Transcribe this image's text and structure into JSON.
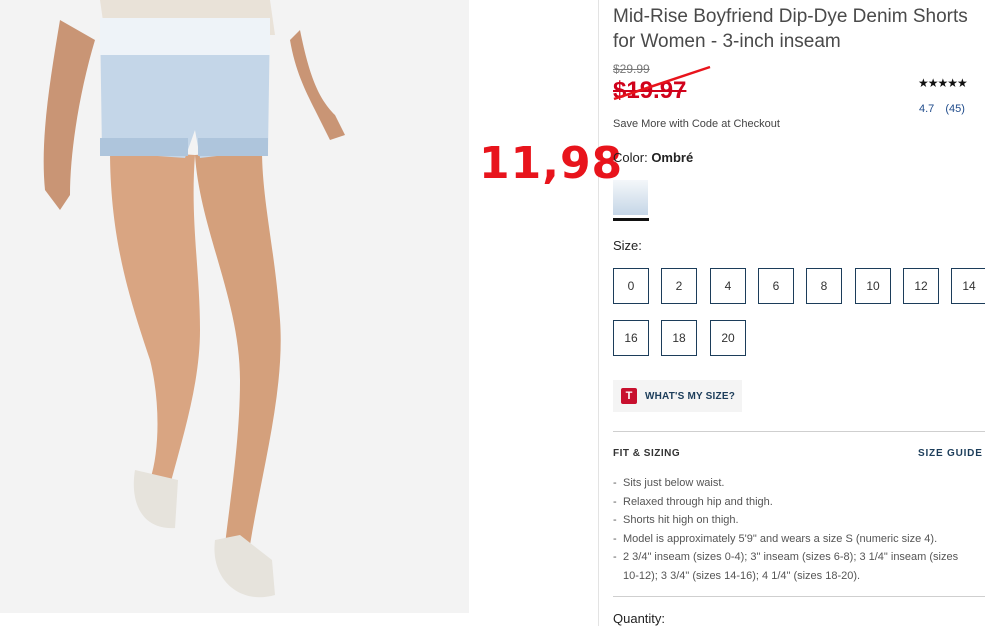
{
  "product": {
    "title_line1": "Mid-Rise Boyfriend Dip-Dye Denim Shorts",
    "title_line2": "for Women - 3-inch inseam",
    "price_original": "$29.99",
    "price_sale": "$19.97",
    "promo_text": "Save More with Code at Checkout",
    "rating": {
      "stars_glyphs": "★★★★★",
      "value": "4.7",
      "count": "(45)"
    }
  },
  "overlay": {
    "annotated_price": "11,98",
    "annotation_color": "#e8141c"
  },
  "color": {
    "label": "Color:",
    "selected": "Ombré"
  },
  "sizes": {
    "label": "Size:",
    "options": [
      "0",
      "2",
      "4",
      "6",
      "8",
      "10",
      "12",
      "14",
      "16",
      "18",
      "20"
    ]
  },
  "whats_my_size": {
    "logo_letter": "T",
    "label": "WHAT'S MY SIZE?"
  },
  "fit": {
    "title": "FIT & SIZING",
    "size_guide_link": "SIZE GUIDE",
    "bullets": [
      "Sits just below waist.",
      "Relaxed through hip and thigh.",
      "Shorts hit high on thigh.",
      "Model is approximately 5'9\" and wears a size S (numeric size 4).",
      "2 3/4\" inseam (sizes 0-4); 3\" inseam (sizes 6-8); 3 1/4\" inseam (sizes",
      "10-12); 3 3/4\" (sizes 14-16); 4 1/4\" (sizes 18-20)."
    ]
  },
  "quantity": {
    "label": "Quantity:"
  },
  "colors": {
    "brand_navy": "#1c3d5a",
    "sale_red": "#d0021b",
    "rating_blue": "#1e4a8a"
  }
}
